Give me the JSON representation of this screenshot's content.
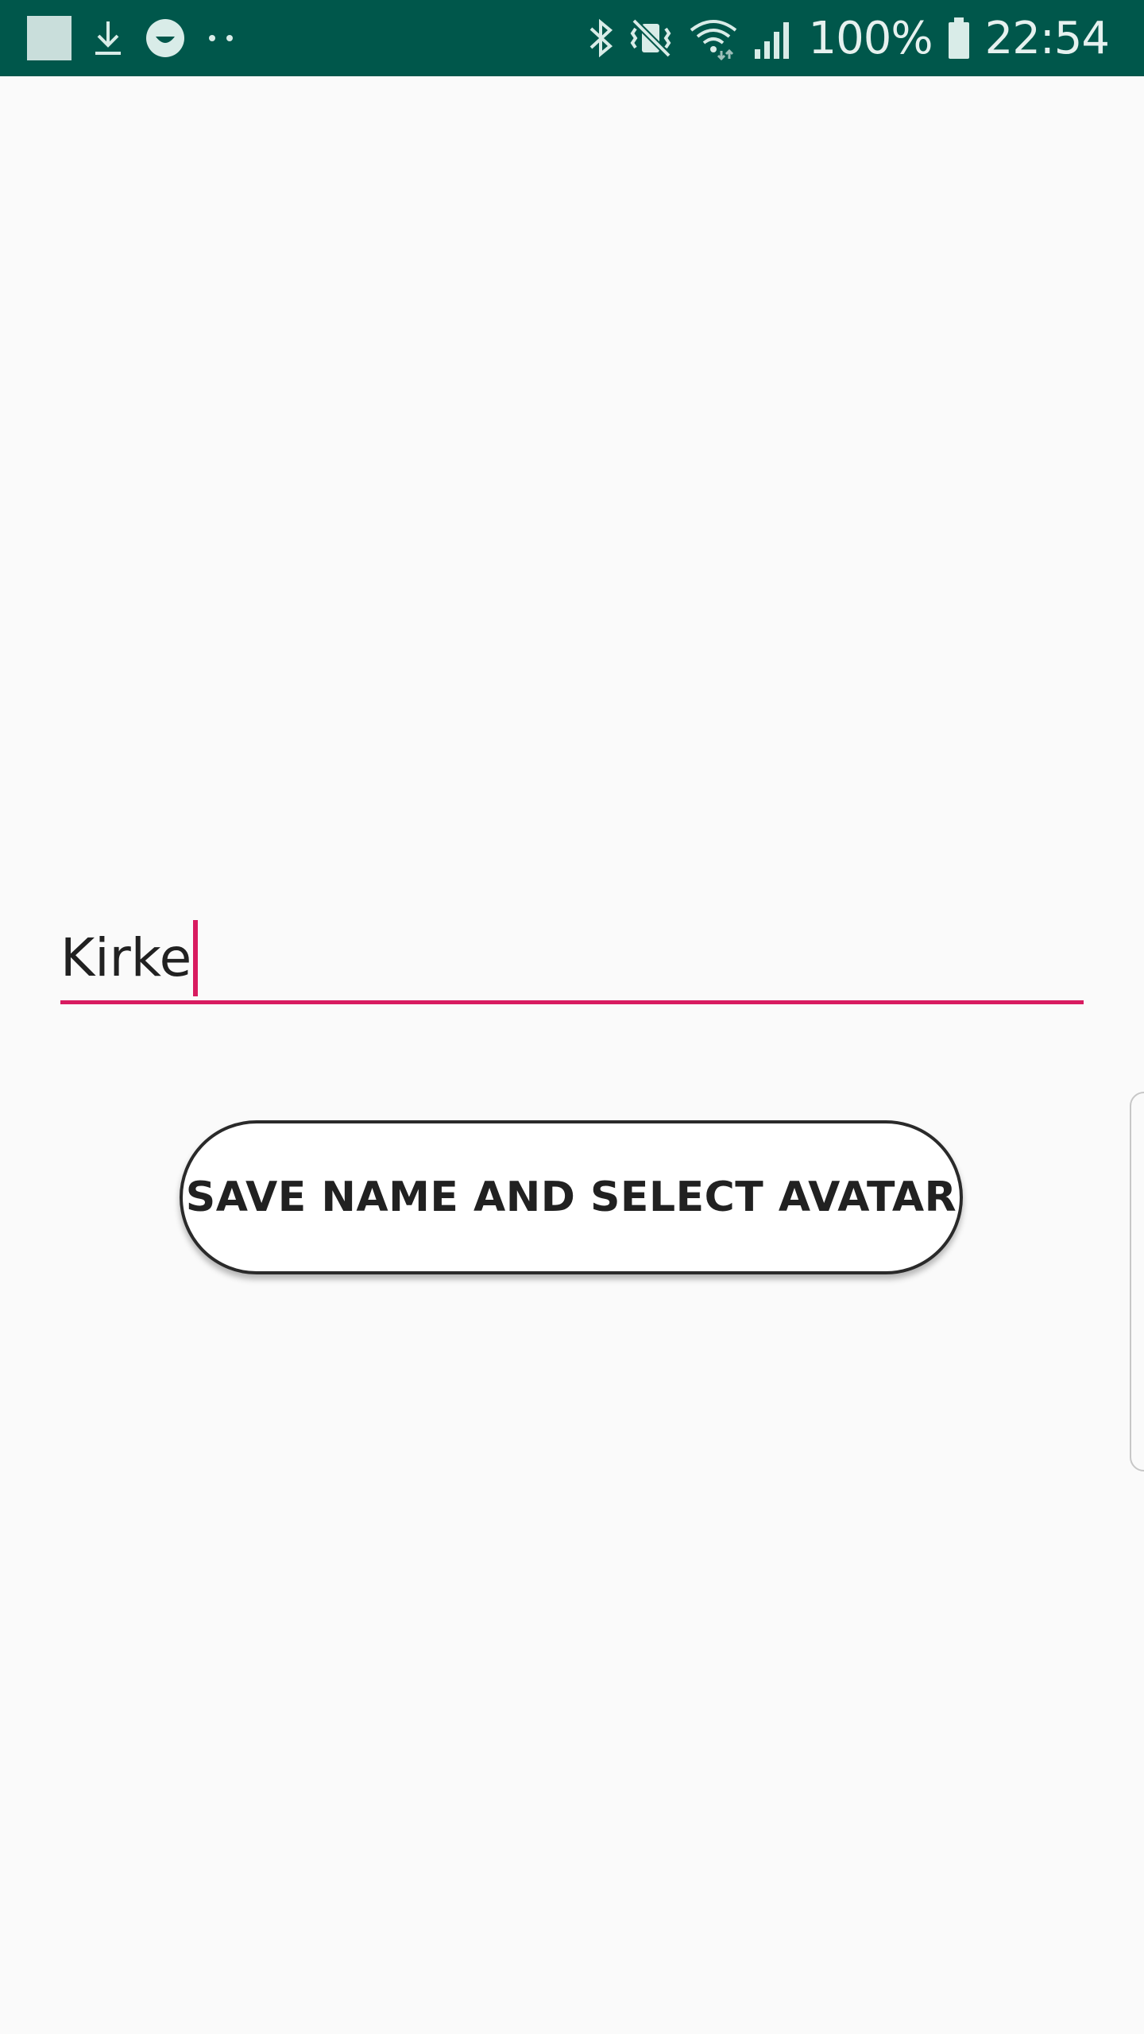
{
  "status_bar": {
    "left_icons": [
      "notification-square-icon",
      "download-icon",
      "smiley-icon",
      "more-dots-icon"
    ],
    "right_icons": [
      "bluetooth-icon",
      "mute-vibrate-icon",
      "wifi-icon",
      "signal-icon",
      "battery-icon"
    ],
    "battery_text": "100%",
    "time": "22:54",
    "colors": {
      "background": "#00574b",
      "icon": "#d9ece8"
    }
  },
  "form": {
    "name_value": "Kirke",
    "accent_color": "#d81b60"
  },
  "actions": {
    "save_label": "SAVE NAME AND SELECT AVATAR"
  }
}
